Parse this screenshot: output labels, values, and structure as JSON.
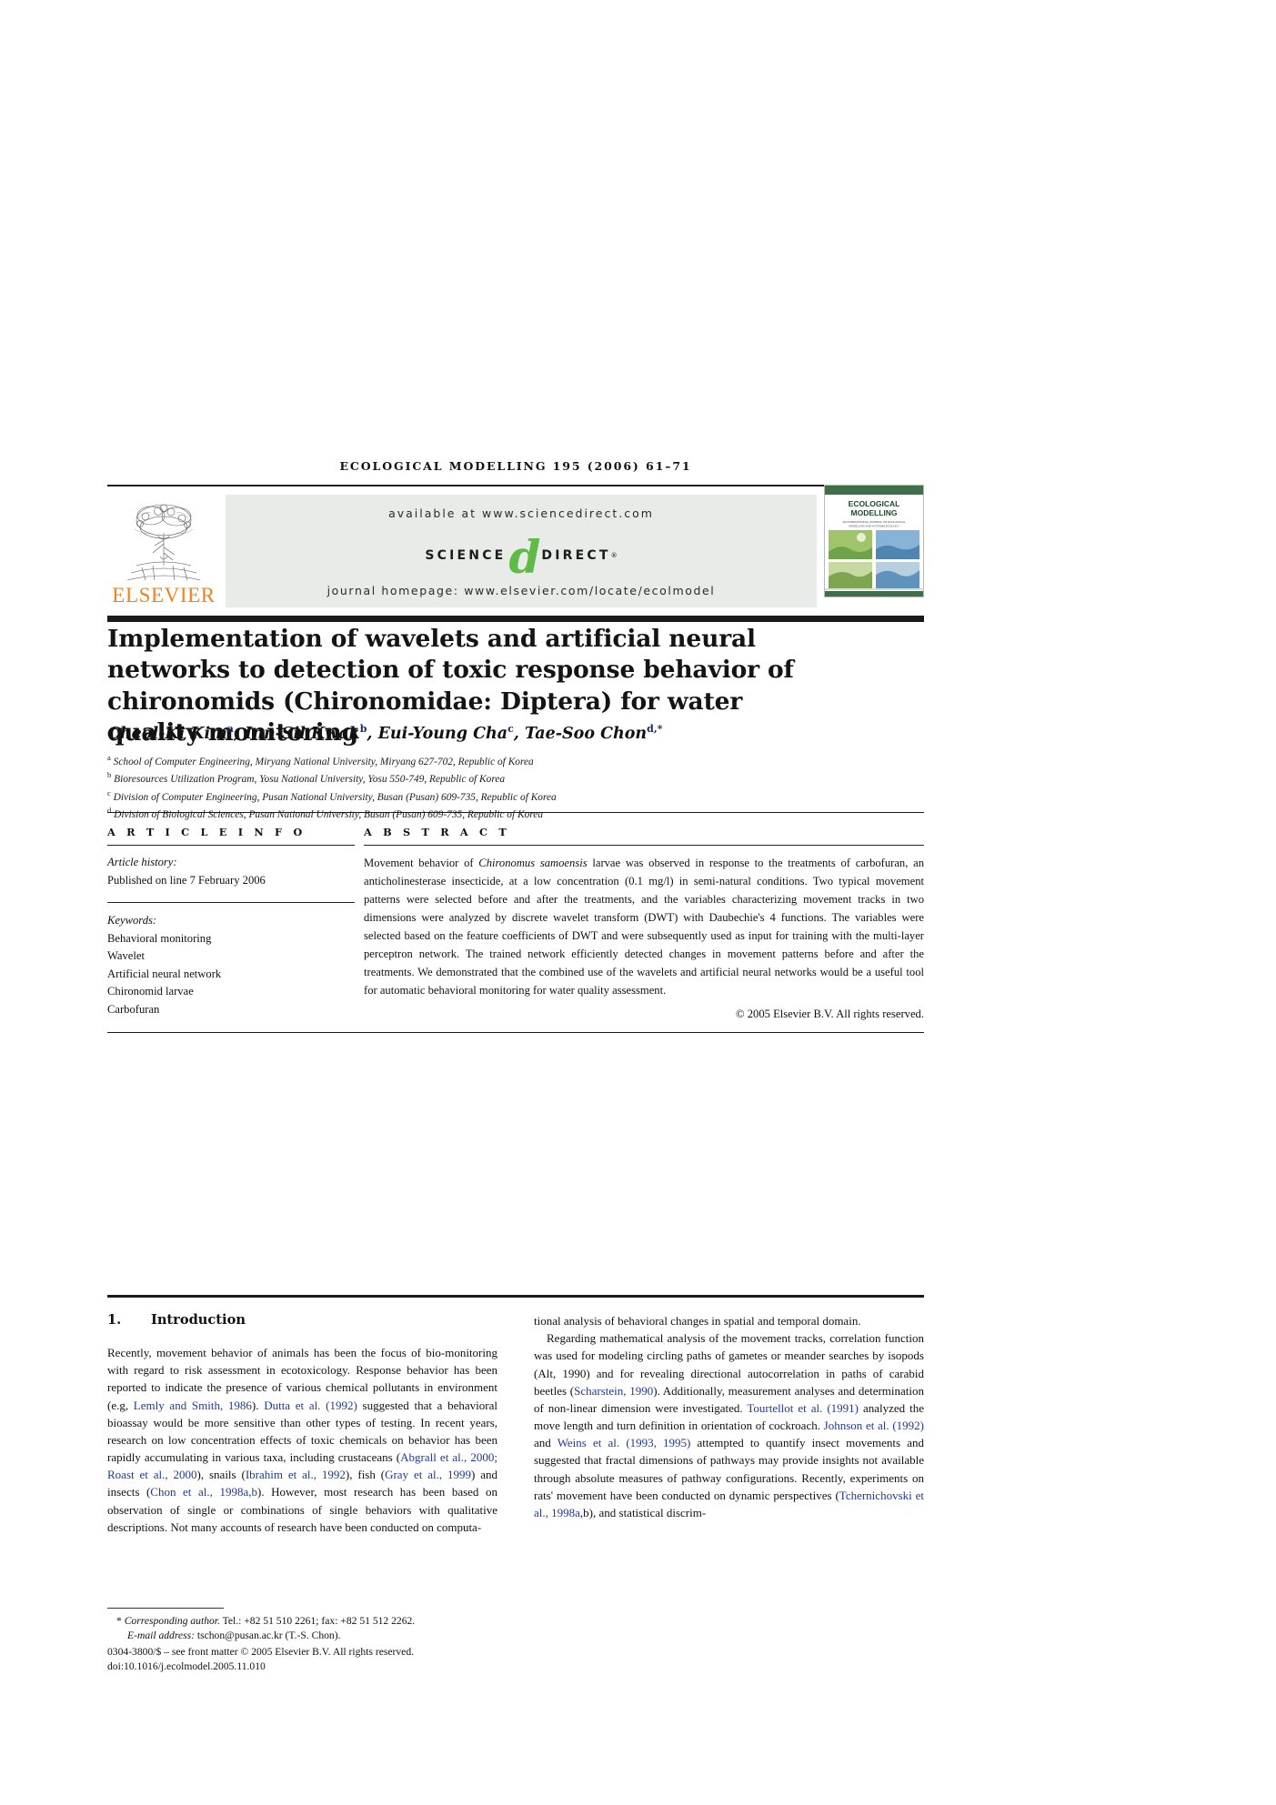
{
  "running_head": "ECOLOGICAL MODELLING 195 (2006) 61–71",
  "masthead": {
    "publisher": "ELSEVIER",
    "available_at": "available at www.sciencedirect.com",
    "logo_science": "SCIENCE",
    "logo_d": "d",
    "logo_direct": "DIRECT",
    "journal_homepage": "journal homepage: www.elsevier.com/locate/ecolmodel",
    "cover_title_line1": "ECOLOGICAL",
    "cover_title_line2": "MODELLING",
    "cover_sub": "AN INTERNATIONAL JOURNAL ON ECOLOGICAL MODELLING AND SYSTEMS ECOLOGY",
    "green_hex": "#5FBA46",
    "orange_hex": "#F08221",
    "banner_bg_hex": "#E8EBE8"
  },
  "title": "Implementation of wavelets and artificial neural networks to detection of toxic response behavior of chironomids (Chironomidae: Diptera) for water quality monitoring",
  "authors": [
    {
      "name": "Cheol-Ki Kim",
      "sup": "a"
    },
    {
      "name": "Inn-Sil Kwak",
      "sup": "b"
    },
    {
      "name": "Eui-Young Cha",
      "sup": "c"
    },
    {
      "name": "Tae-Soo Chon",
      "sup": "d,*"
    }
  ],
  "affiliations": [
    {
      "marker": "a",
      "text": "School of Computer Engineering, Miryang National University, Miryang 627-702, Republic of Korea"
    },
    {
      "marker": "b",
      "text": "Bioresources Utilization Program, Yosu National University, Yosu 550-749, Republic of Korea"
    },
    {
      "marker": "c",
      "text": "Division of Computer Engineering, Pusan National University, Busan (Pusan) 609-735, Republic of Korea"
    },
    {
      "marker": "d",
      "text": "Division of Biological Sciences, Pusan National University, Busan (Pusan) 609-735, Republic of Korea"
    }
  ],
  "article_info": {
    "heading": "A R T I C L E   I N F O",
    "history_label": "Article history:",
    "history_value": "Published on line 7 February 2006",
    "keywords_label": "Keywords:",
    "keywords": [
      "Behavioral monitoring",
      "Wavelet",
      "Artificial neural network",
      "Chironomid larvae",
      "Carbofuran"
    ]
  },
  "abstract": {
    "heading": "A B S T R A C T",
    "text_pre": "Movement behavior of ",
    "species": "Chironomus samoensis",
    "text_post": " larvae was observed in response to the treatments of carbofuran, an anticholinesterase insecticide, at a low concentration (0.1 mg/l) in semi-natural conditions. Two typical movement patterns were selected before and after the treatments, and the variables characterizing movement tracks in two dimensions were analyzed by discrete wavelet transform (DWT) with Daubechie's 4 functions. The variables were selected based on the feature coefficients of DWT and were subsequently used as input for training with the multi-layer perceptron network. The trained network efficiently detected changes in movement patterns before and after the treatments. We demonstrated that the combined use of the wavelets and artificial neural networks would be a useful tool for automatic behavioral monitoring for water quality assessment.",
    "copyright": "© 2005 Elsevier B.V. All rights reserved."
  },
  "section": {
    "number": "1.",
    "heading": "Introduction"
  },
  "body": {
    "left_p1_a": "Recently, movement behavior of animals has been the focus of bio-monitoring with regard to risk assessment in ecotoxicology. Response behavior has been reported to indicate the presence of various chemical pollutants in environment (e.g, ",
    "left_cite1": "Lemly and Smith, 1986",
    "left_p1_b": "). ",
    "left_cite2": "Dutta et al. (1992)",
    "left_p1_c": " suggested that a behavioral bioassay would be more sensitive than other types of testing. In recent years, research on low concentration effects of toxic chemicals on behavior has been rapidly accumulating in various taxa, including crustaceans (",
    "left_cite3": "Abgrall et al., 2000; Roast et al., 2000",
    "left_p1_d": "), snails (",
    "left_cite4": "Ibrahim et al., 1992",
    "left_p1_e": "), fish (",
    "left_cite5": "Gray et al., 1999",
    "left_p1_f": ") and insects (",
    "left_cite6": "Chon et al., 1998a,b",
    "left_p1_g": "). However, most research has been based on observation of single or combinations of single behaviors with qualitative descriptions. Not many accounts of research have been conducted on computa-",
    "right_p1": "tional analysis of behavioral changes in spatial and temporal domain.",
    "right_p2_a": "Regarding mathematical analysis of the movement tracks, correlation function was used for modeling circling paths of gametes or meander searches by isopods (Alt, 1990) and for revealing directional autocorrelation in paths of carabid beetles (",
    "right_cite1": "Scharstein, 1990",
    "right_p2_b": "). Additionally, measurement analyses and determination of non-linear dimension were investigated. ",
    "right_cite2": "Tourtellot et al. (1991)",
    "right_p2_c": " analyzed the move length and turn definition in orientation of cockroach. ",
    "right_cite3": "Johnson et al. (1992)",
    "right_p2_d": " and ",
    "right_cite4": "Weins et al. (1993, 1995)",
    "right_p2_e": " attempted to quantify insect movements and suggested that fractal dimensions of pathways may provide insights not available through absolute measures of pathway configurations. Recently, experiments on rats' movement have been conducted on dynamic perspectives (",
    "right_cite5": "Tchernichovski et al., 1998a",
    "right_p2_f": ",b), and statistical discrim-"
  },
  "footnote": {
    "star": "*",
    "corresponding_label": "Corresponding author.",
    "corresponding_rest": " Tel.: +82 51 510 2261; fax: +82 51 512 2262.",
    "email_label": "E-mail address:",
    "email_value": " tschon@pusan.ac.kr (T.-S. Chon).",
    "issn_line": "0304-3800/$ – see front matter © 2005 Elsevier B.V. All rights reserved.",
    "doi_line": "doi:10.1016/j.ecolmodel.2005.11.010"
  }
}
